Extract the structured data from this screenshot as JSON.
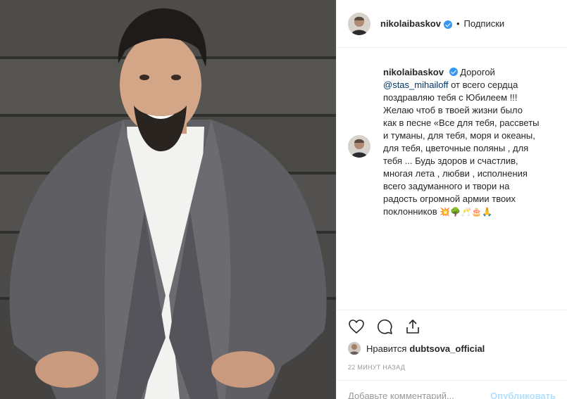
{
  "header": {
    "username": "nikolaibaskov",
    "separator": "•",
    "follow_label": "Подписки"
  },
  "caption": {
    "username": "nikolaibaskov",
    "lead": "Дорогой",
    "mention": "@stas_mihailoff",
    "body": "от всего сердца\nпоздравляю тебя с Юбилеем !!!\nЖелаю чтоб в твоей жизни было\nкак в песне «Все для тебя, рассветы\nи туманы, для тебя, моря и океаны,\nдля тебя, цветочные поляны , для\nтебя ... Будь здоров и счастлив,\nмногая лета , любви , исполнения\nвсего задуманного и твори на\nрадость огромной армии твоих\nпоклонников",
    "emojis": "💥🌳🥂🎂🙏"
  },
  "likes": {
    "prefix": "Нравится",
    "user": "dubtsova_official"
  },
  "time": "22 МИНУТ НАЗАД",
  "comment": {
    "placeholder": "Добавьте комментарий...",
    "post_label": "Опубликовать"
  },
  "colors": {
    "verified": "#3897f0",
    "mention": "#003569",
    "muted": "#999999"
  }
}
